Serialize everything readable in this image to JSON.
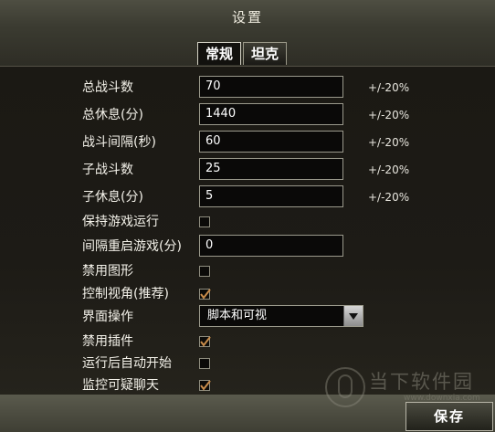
{
  "window": {
    "title": "设置"
  },
  "tabs": [
    {
      "label": "常规",
      "active": true
    },
    {
      "label": "坦克",
      "active": false
    }
  ],
  "fields": [
    {
      "label": "总战斗数",
      "value": "70",
      "range": "+/-20%"
    },
    {
      "label": "总休息(分)",
      "value": "1440",
      "range": "+/-20%"
    },
    {
      "label": "战斗间隔(秒)",
      "value": "60",
      "range": "+/-20%"
    },
    {
      "label": "子战斗数",
      "value": "25",
      "range": "+/-20%"
    },
    {
      "label": "子休息(分)",
      "value": "5",
      "range": "+/-20%"
    }
  ],
  "keep_running": {
    "label": "保持游戏运行",
    "checked": false
  },
  "restart_interval": {
    "label": "间隔重启游戏(分)",
    "value": "0"
  },
  "disable_graphics": {
    "label": "禁用图形",
    "checked": false
  },
  "control_view": {
    "label": "控制视角(推荐)",
    "checked": true
  },
  "ui_operation": {
    "label": "界面操作",
    "selected": "脚本和可视"
  },
  "disable_plugins": {
    "label": "禁用插件",
    "checked": true
  },
  "auto_start": {
    "label": "运行后自动开始",
    "checked": false
  },
  "monitor_chat": {
    "label": "监控可疑聊天",
    "checked": true
  },
  "footer": {
    "save_label": "保存"
  },
  "watermark": {
    "text": "当下软件园",
    "url": "www.downxia.com"
  },
  "colors": {
    "accent_check": "#c98c4a",
    "panel_bg": "#1c1a15"
  }
}
